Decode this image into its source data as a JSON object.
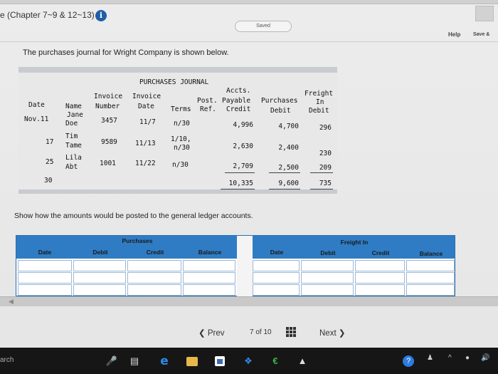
{
  "header": {
    "chapter_title": "e (Chapter 7~9 & 12~13)",
    "saved": "Saved",
    "help": "Help",
    "save": "Save &"
  },
  "intro": "The purchases journal for Wright Company is shown below.",
  "journal": {
    "title": "PURCHASES JOURNAL",
    "headers": {
      "date": "Date",
      "name": "Name",
      "invoice_number_1": "Invoice",
      "invoice_number_2": "Number",
      "invoice_date_1": "Invoice",
      "invoice_date_2": "Date",
      "terms": "Terms",
      "post_ref_1": "Post.",
      "post_ref_2": "Ref.",
      "accts_1": "Accts.",
      "accts_2": "Payable",
      "accts_3": "Credit",
      "purchases_1": "Purchases",
      "purchases_2": "Debit",
      "freight_1": "Freight",
      "freight_2": "In",
      "freight_3": "Debit"
    },
    "rows": [
      {
        "date": "Nov.11",
        "name_1": "Jane",
        "name_2": "Doe",
        "number": "3457",
        "inv_date": "11/7",
        "terms_1": "n/30",
        "terms_2": "",
        "ap": "4,996",
        "purchases": "4,700",
        "freight": "296"
      },
      {
        "date": "17",
        "name_1": "Tim",
        "name_2": "Tame",
        "number": "9589",
        "inv_date": "11/13",
        "terms_1": "1/10,",
        "terms_2": "n/30",
        "ap": "2,630",
        "purchases": "2,400",
        "freight": "230"
      },
      {
        "date": "25",
        "name_1": "Lila",
        "name_2": "Abt",
        "number": "1001",
        "inv_date": "11/22",
        "terms_1": "n/30",
        "terms_2": "",
        "ap": "2,709",
        "purchases": "2,500",
        "freight": "209"
      }
    ],
    "total": {
      "date": "30",
      "ap": "10,335",
      "purchases": "9,600",
      "freight": "735"
    }
  },
  "instruction": "Show how the amounts would be posted to the general ledger accounts.",
  "ledger": {
    "purchases": {
      "title": "Purchases",
      "date": "Date",
      "debit": "Debit",
      "credit": "Credit",
      "balance": "Balance"
    },
    "freight": {
      "title": "Freight In",
      "date": "Date",
      "debit": "Debit",
      "credit": "Credit",
      "balance": "Balance"
    }
  },
  "nav": {
    "prev": "Prev",
    "page_current": "7",
    "page_of": "of",
    "page_total": "10",
    "next": "Next"
  },
  "taskbar": {
    "search": "arch"
  },
  "colors": {
    "ledger_header": "#2f7cc4",
    "info_icon": "#1f5fa8"
  }
}
